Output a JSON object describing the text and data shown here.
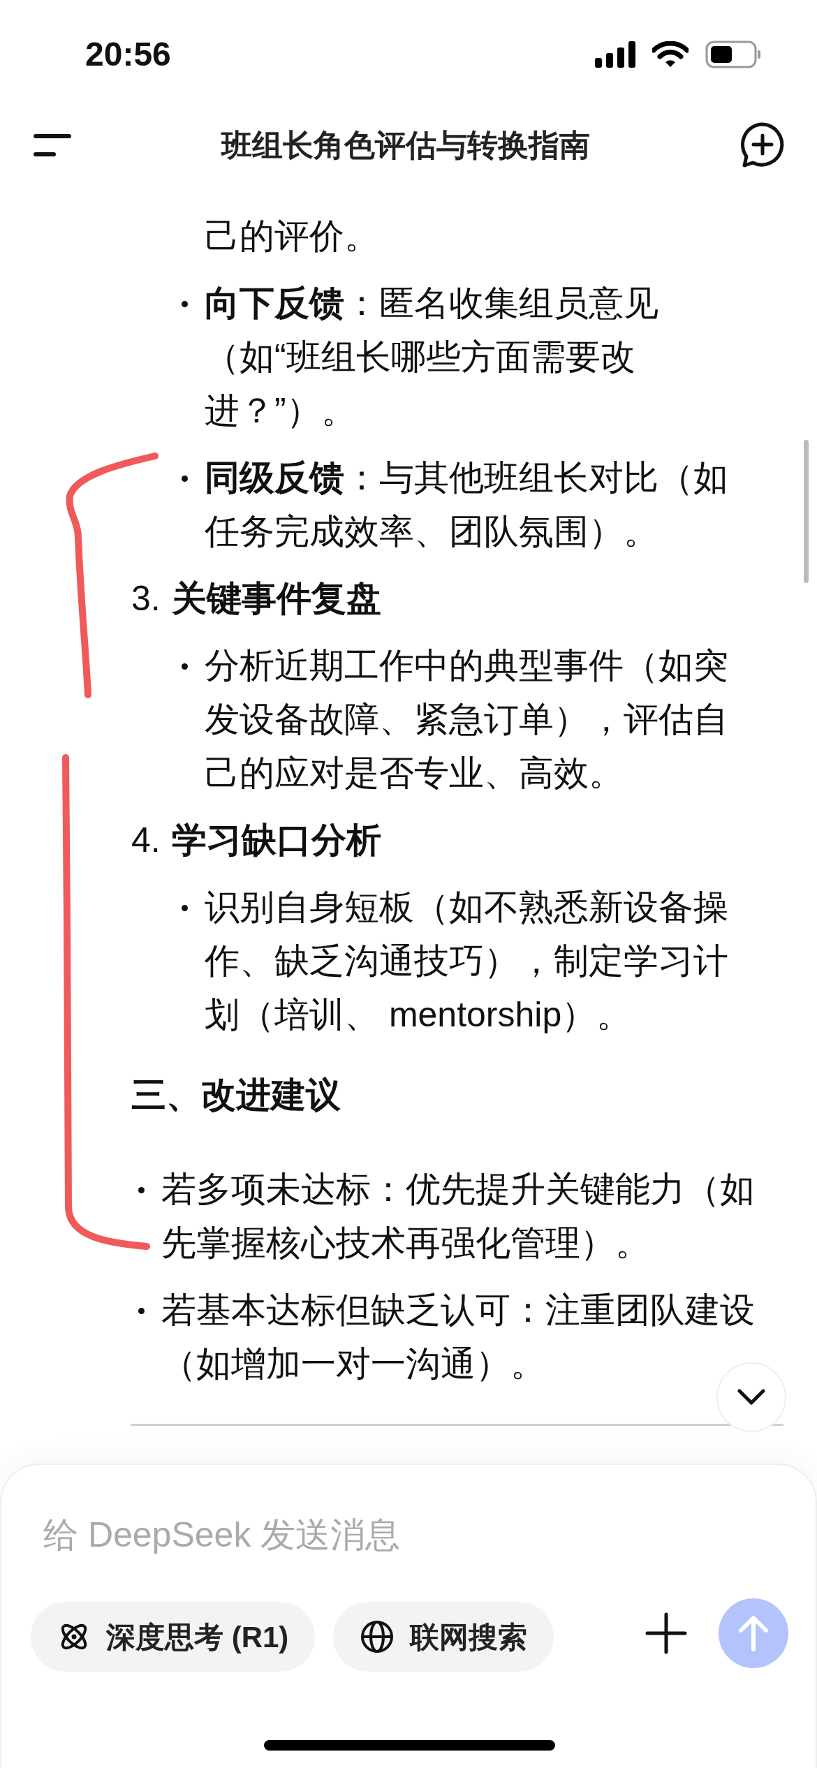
{
  "status_bar": {
    "time": "20:56"
  },
  "header": {
    "title": "班组长角色评估与转换指南"
  },
  "content": [
    {
      "kind": "sublist",
      "items": [
        {
          "kind": "continuation",
          "text": "己的评价。"
        },
        {
          "kind": "bullet",
          "text": "**向下反馈**：匿名收集组员意见（如“班组长哪些方面需要改进？”）。"
        },
        {
          "kind": "bullet",
          "text": "**同级反馈**：与其他班组长对比（如任务完成效率、团队氛围）。"
        }
      ]
    },
    {
      "kind": "numbered",
      "number": "3.",
      "title": "关键事件复盘",
      "items": [
        {
          "kind": "bullet",
          "text": "分析近期工作中的典型事件（如突发设备故障、紧急订单），评估自己的应对是否专业、高效。"
        }
      ]
    },
    {
      "kind": "numbered",
      "number": "4.",
      "title": "学习缺口分析",
      "items": [
        {
          "kind": "bullet",
          "text": "识别自身短板（如不熟悉新设备操作、缺乏沟通技巧），制定学习计划（培训、 mentorship）。"
        }
      ]
    },
    {
      "kind": "heading",
      "title": "三、改进建议"
    },
    {
      "kind": "bullets",
      "items": [
        {
          "kind": "bullet",
          "text": "若多项未达标：优先提升关键能力（如先掌握核心技术再强化管理）。"
        },
        {
          "kind": "bullet",
          "text": "若基本达标但缺乏认可：注重团队建设（如增加一对一沟通）。"
        }
      ]
    }
  ],
  "composer": {
    "placeholder": "给 DeepSeek 发送消息",
    "chips": [
      {
        "label": "深度思考 (R1)",
        "selected": false
      },
      {
        "label": "联网搜索",
        "selected": false
      }
    ],
    "send_disabled": true
  }
}
